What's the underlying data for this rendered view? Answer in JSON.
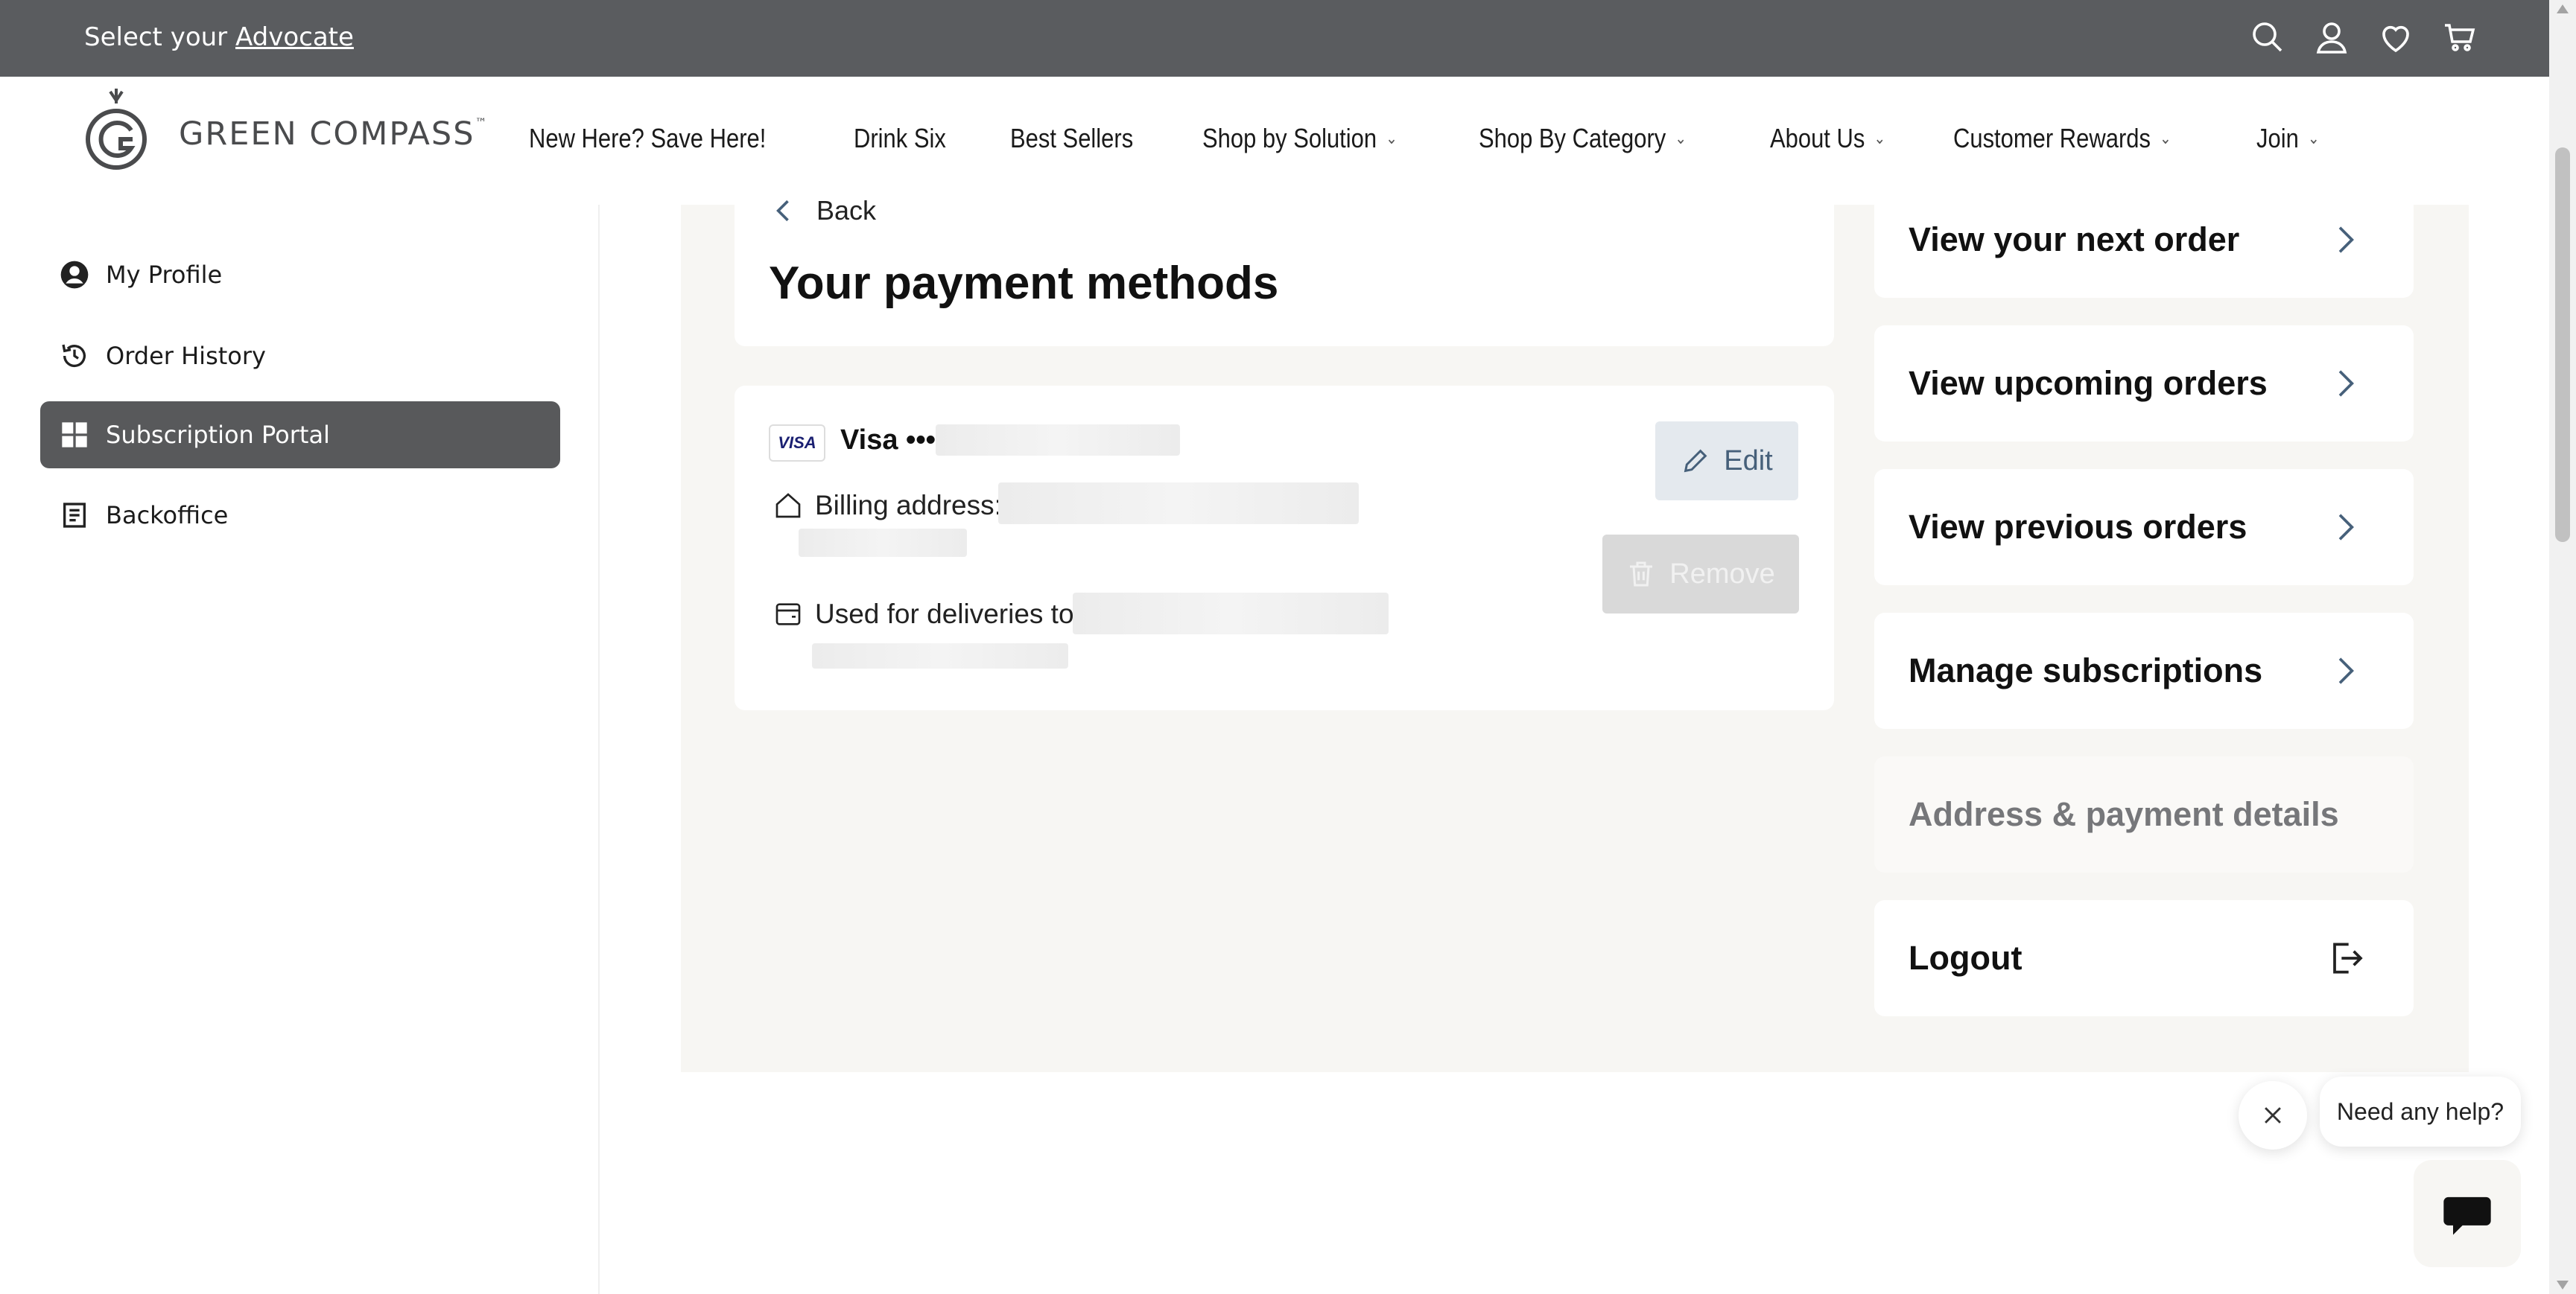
{
  "topbar": {
    "prefix": "Select your ",
    "advocate_link": "Advocate",
    "icons": [
      "search-icon",
      "account-icon",
      "heart-icon",
      "cart-icon"
    ]
  },
  "brand": {
    "name": "GREEN COMPASS",
    "tm": "™"
  },
  "nav": {
    "items": [
      {
        "label": "New Here? Save Here!",
        "dropdown": false
      },
      {
        "label": "Drink Six",
        "dropdown": false
      },
      {
        "label": "Best Sellers",
        "dropdown": false
      },
      {
        "label": "Shop by Solution",
        "dropdown": true
      },
      {
        "label": "Shop By Category",
        "dropdown": true
      },
      {
        "label": "About Us",
        "dropdown": true
      },
      {
        "label": "Customer Rewards",
        "dropdown": true
      },
      {
        "label": "Join",
        "dropdown": true
      }
    ]
  },
  "sidebar": {
    "items": [
      {
        "label": "My Profile",
        "icon": "user-circle-icon",
        "active": false
      },
      {
        "label": "Order History",
        "icon": "history-icon",
        "active": false
      },
      {
        "label": "Subscription Portal",
        "icon": "grid-icon",
        "active": true
      },
      {
        "label": "Backoffice",
        "icon": "document-icon",
        "active": false
      }
    ]
  },
  "main": {
    "back_label": "Back",
    "title": "Your payment methods",
    "card": {
      "label": "Visa ••••",
      "billing_label": "Billing address:",
      "deliveries_label": "Used for deliveries to",
      "edit_label": "Edit",
      "remove_label": "Remove"
    }
  },
  "right_nav": [
    {
      "label": "View your next order",
      "icon": "chevron-right-icon"
    },
    {
      "label": "View upcoming orders",
      "icon": "chevron-right-icon"
    },
    {
      "label": "View previous orders",
      "icon": "chevron-right-icon"
    },
    {
      "label": "Manage subscriptions",
      "icon": "chevron-right-icon"
    },
    {
      "label": "Address & payment details",
      "icon": ""
    },
    {
      "label": "Logout",
      "icon": "logout-icon"
    }
  ],
  "chat": {
    "bubble_text": "Need any help?"
  },
  "colors": {
    "topbar": "#5a5c5f",
    "active_sidebar": "#58595b",
    "panel_bg": "#f7f6f3",
    "edit_text": "#46607a"
  }
}
